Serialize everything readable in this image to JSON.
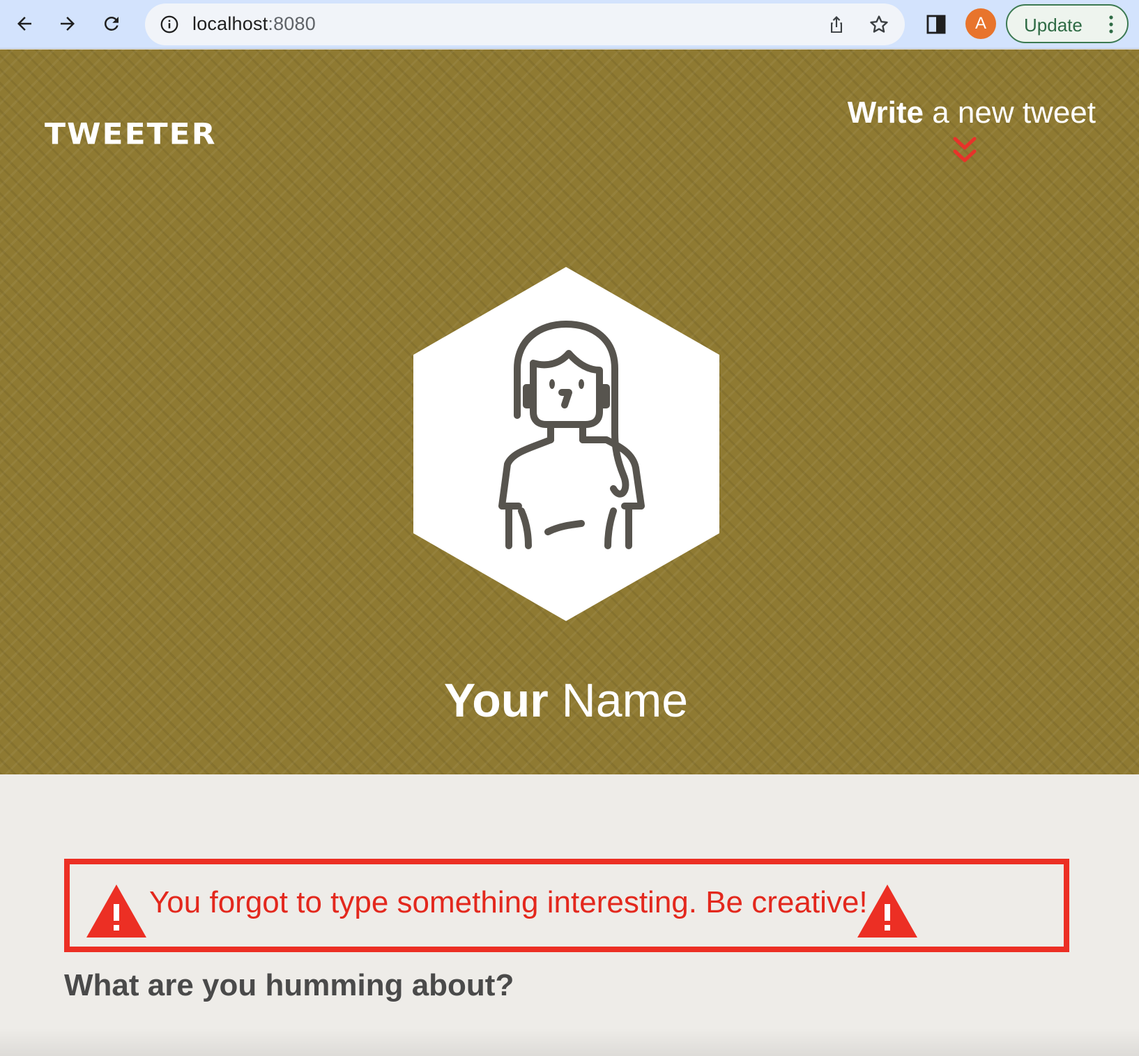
{
  "browser": {
    "url_host": "localhost",
    "url_port": ":8080",
    "profile_initial": "A",
    "update_label": "Update",
    "accent_colors": {
      "toolbar": "#d3e3fd",
      "avatar": "#e8742c",
      "update_border": "#3c7a52"
    },
    "icons": [
      "back-arrow-icon",
      "forward-arrow-icon",
      "reload-icon",
      "site-info-icon",
      "share-icon",
      "star-icon",
      "side-panel-icon",
      "more-vert-icon"
    ]
  },
  "header": {
    "logo": "TWEETER",
    "compose_toggle": {
      "bold": "Write",
      "rest": " a new tweet",
      "icon": "double-chevron-down-icon"
    }
  },
  "profile": {
    "avatar_icon": "user-avatar-icon",
    "name_bold": "Your",
    "name_rest": " Name"
  },
  "compose": {
    "error_message": "You forgot to type something interesting. Be creative!",
    "error_icon": "warning-triangle-icon",
    "prompt": "What are you humming about?"
  },
  "colors": {
    "hero_background": "#8f7a32",
    "error_red": "#ec2f24",
    "page_background": "#eeece8"
  }
}
